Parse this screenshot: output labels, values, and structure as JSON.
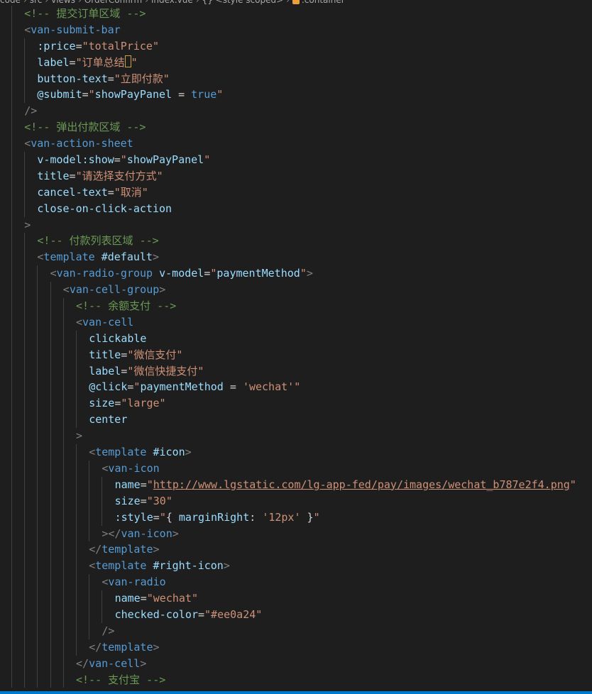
{
  "breadcrumb": [
    "code",
    "src",
    "views",
    "OrderConfirm",
    "index.vue",
    "{} <style scoped>",
    ".container"
  ],
  "lines": [
    {
      "indent": 1,
      "tokens": [
        [
          "cm",
          "<!-- 提交订单区域 -->"
        ]
      ]
    },
    {
      "indent": 1,
      "tokens": [
        [
          "pc",
          "<"
        ],
        [
          "tg",
          "van-submit-bar"
        ]
      ]
    },
    {
      "indent": 2,
      "tokens": [
        [
          "at",
          ":price"
        ],
        [
          "eq",
          "="
        ],
        [
          "st",
          "\"totalPrice\""
        ]
      ]
    },
    {
      "indent": 2,
      "tokens": [
        [
          "at",
          "label"
        ],
        [
          "eq",
          "="
        ],
        [
          "st",
          "\"订单总结"
        ],
        [
          "cur",
          ""
        ],
        [
          "st",
          "\""
        ]
      ]
    },
    {
      "indent": 2,
      "tokens": [
        [
          "at",
          "button-text"
        ],
        [
          "eq",
          "="
        ],
        [
          "st",
          "\"立即付款\""
        ]
      ]
    },
    {
      "indent": 2,
      "tokens": [
        [
          "at",
          "@submit"
        ],
        [
          "eq",
          "="
        ],
        [
          "st",
          "\""
        ],
        [
          "at",
          "showPayPanel"
        ],
        [
          "eq",
          " = "
        ],
        [
          "kw",
          "true"
        ],
        [
          "st",
          "\""
        ]
      ]
    },
    {
      "indent": 1,
      "tokens": [
        [
          "pc",
          "/>"
        ]
      ]
    },
    {
      "indent": 1,
      "tokens": [
        [
          "cm",
          "<!-- 弹出付款区域 -->"
        ]
      ]
    },
    {
      "indent": 1,
      "tokens": [
        [
          "pc",
          "<"
        ],
        [
          "tg",
          "van-action-sheet"
        ]
      ]
    },
    {
      "indent": 2,
      "tokens": [
        [
          "at",
          "v-model:show"
        ],
        [
          "eq",
          "="
        ],
        [
          "st",
          "\""
        ],
        [
          "at",
          "showPayPanel"
        ],
        [
          "st",
          "\""
        ]
      ]
    },
    {
      "indent": 2,
      "tokens": [
        [
          "at",
          "title"
        ],
        [
          "eq",
          "="
        ],
        [
          "st",
          "\"请选择支付方式\""
        ]
      ]
    },
    {
      "indent": 2,
      "tokens": [
        [
          "at",
          "cancel-text"
        ],
        [
          "eq",
          "="
        ],
        [
          "st",
          "\"取消\""
        ]
      ]
    },
    {
      "indent": 2,
      "tokens": [
        [
          "at",
          "close-on-click-action"
        ]
      ]
    },
    {
      "indent": 1,
      "tokens": [
        [
          "pc",
          ">"
        ]
      ]
    },
    {
      "indent": 2,
      "tokens": [
        [
          "cm",
          "<!-- 付款列表区域 -->"
        ]
      ]
    },
    {
      "indent": 2,
      "tokens": [
        [
          "pc",
          "<"
        ],
        [
          "tg",
          "template"
        ],
        [
          "eq",
          " "
        ],
        [
          "at",
          "#default"
        ],
        [
          "pc",
          ">"
        ]
      ]
    },
    {
      "indent": 3,
      "tokens": [
        [
          "pc",
          "<"
        ],
        [
          "tg",
          "van-radio-group"
        ],
        [
          "eq",
          " "
        ],
        [
          "at",
          "v-model"
        ],
        [
          "eq",
          "="
        ],
        [
          "st",
          "\""
        ],
        [
          "at",
          "paymentMethod"
        ],
        [
          "st",
          "\""
        ],
        [
          "pc",
          ">"
        ]
      ]
    },
    {
      "indent": 4,
      "tokens": [
        [
          "pc",
          "<"
        ],
        [
          "tg",
          "van-cell-group"
        ],
        [
          "pc",
          ">"
        ]
      ]
    },
    {
      "indent": 5,
      "tokens": [
        [
          "cm",
          "<!-- 余额支付 -->"
        ]
      ]
    },
    {
      "indent": 5,
      "tokens": [
        [
          "pc",
          "<"
        ],
        [
          "tg",
          "van-cell"
        ]
      ]
    },
    {
      "indent": 6,
      "tokens": [
        [
          "at",
          "clickable"
        ]
      ]
    },
    {
      "indent": 6,
      "tokens": [
        [
          "at",
          "title"
        ],
        [
          "eq",
          "="
        ],
        [
          "st",
          "\"微信支付\""
        ]
      ]
    },
    {
      "indent": 6,
      "tokens": [
        [
          "at",
          "label"
        ],
        [
          "eq",
          "="
        ],
        [
          "st",
          "\"微信快捷支付\""
        ]
      ]
    },
    {
      "indent": 6,
      "tokens": [
        [
          "at",
          "@click"
        ],
        [
          "eq",
          "="
        ],
        [
          "st",
          "\""
        ],
        [
          "at",
          "paymentMethod"
        ],
        [
          "eq",
          " = "
        ],
        [
          "st",
          "'wechat'"
        ],
        [
          "st",
          "\""
        ]
      ]
    },
    {
      "indent": 6,
      "tokens": [
        [
          "at",
          "size"
        ],
        [
          "eq",
          "="
        ],
        [
          "st",
          "\"large\""
        ]
      ]
    },
    {
      "indent": 6,
      "tokens": [
        [
          "at",
          "center"
        ]
      ]
    },
    {
      "indent": 5,
      "tokens": [
        [
          "pc",
          ">"
        ]
      ]
    },
    {
      "indent": 6,
      "tokens": [
        [
          "pc",
          "<"
        ],
        [
          "tg",
          "template"
        ],
        [
          "eq",
          " "
        ],
        [
          "at",
          "#icon"
        ],
        [
          "pc",
          ">"
        ]
      ]
    },
    {
      "indent": 7,
      "tokens": [
        [
          "pc",
          "<"
        ],
        [
          "tg",
          "van-icon"
        ]
      ]
    },
    {
      "indent": 8,
      "tokens": [
        [
          "at",
          "name"
        ],
        [
          "eq",
          "="
        ],
        [
          "st",
          "\""
        ],
        [
          "lk",
          "http://www.lgstatic.com/lg-app-fed/pay/images/wechat_b787e2f4.png"
        ],
        [
          "st",
          "\""
        ]
      ]
    },
    {
      "indent": 8,
      "tokens": [
        [
          "at",
          "size"
        ],
        [
          "eq",
          "="
        ],
        [
          "st",
          "\"30\""
        ]
      ]
    },
    {
      "indent": 8,
      "tokens": [
        [
          "at",
          ":style"
        ],
        [
          "eq",
          "="
        ],
        [
          "st",
          "\""
        ],
        [
          "eq",
          "{ "
        ],
        [
          "at",
          "marginRight"
        ],
        [
          "eq",
          ": "
        ],
        [
          "st",
          "'12px'"
        ],
        [
          "eq",
          " }"
        ],
        [
          "st",
          "\""
        ]
      ]
    },
    {
      "indent": 7,
      "tokens": [
        [
          "pc",
          "></"
        ],
        [
          "tg",
          "van-icon"
        ],
        [
          "pc",
          ">"
        ]
      ]
    },
    {
      "indent": 6,
      "tokens": [
        [
          "pc",
          "</"
        ],
        [
          "tg",
          "template"
        ],
        [
          "pc",
          ">"
        ]
      ]
    },
    {
      "indent": 6,
      "tokens": [
        [
          "pc",
          "<"
        ],
        [
          "tg",
          "template"
        ],
        [
          "eq",
          " "
        ],
        [
          "at",
          "#right-icon"
        ],
        [
          "pc",
          ">"
        ]
      ]
    },
    {
      "indent": 7,
      "tokens": [
        [
          "pc",
          "<"
        ],
        [
          "tg",
          "van-radio"
        ]
      ]
    },
    {
      "indent": 8,
      "tokens": [
        [
          "at",
          "name"
        ],
        [
          "eq",
          "="
        ],
        [
          "st",
          "\"wechat\""
        ]
      ]
    },
    {
      "indent": 8,
      "tokens": [
        [
          "at",
          "checked-color"
        ],
        [
          "eq",
          "="
        ],
        [
          "st",
          "\"#ee0a24\""
        ]
      ]
    },
    {
      "indent": 7,
      "tokens": [
        [
          "pc",
          "/>"
        ]
      ]
    },
    {
      "indent": 6,
      "tokens": [
        [
          "pc",
          "</"
        ],
        [
          "tg",
          "template"
        ],
        [
          "pc",
          ">"
        ]
      ]
    },
    {
      "indent": 5,
      "tokens": [
        [
          "pc",
          "</"
        ],
        [
          "tg",
          "van-cell"
        ],
        [
          "pc",
          ">"
        ]
      ]
    },
    {
      "indent": 5,
      "tokens": [
        [
          "cm",
          "<!-- 支付宝 -->"
        ]
      ]
    }
  ],
  "colors": {
    "background": "#1e1e1e",
    "comment": "#6a9955",
    "tag": "#569cd6",
    "attribute": "#9cdcfe",
    "string": "#ce9178",
    "punctuation": "#808080",
    "statusbar": "#007acc"
  }
}
